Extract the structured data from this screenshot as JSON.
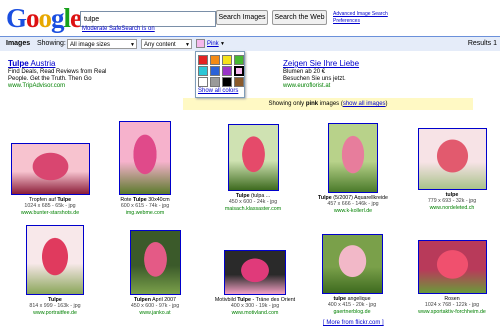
{
  "logo": "Google",
  "search": {
    "value": "tulpe"
  },
  "buttons": {
    "images": "Search Images",
    "web": "Search the Web"
  },
  "links": {
    "advanced": "Advanced Image Search",
    "preferences": "Preferences",
    "safesearch": "Moderate SafeSearch is on"
  },
  "toolbar": {
    "images": "Images",
    "showing": "Showing:",
    "size": "All image sizes",
    "content": "Any content",
    "color": "Pink",
    "results": "Results 1"
  },
  "color_panel": {
    "swatches": [
      "#e32222",
      "#f48a14",
      "#f6e21c",
      "#47b733",
      "#2cc6d6",
      "#2b62d8",
      "#9b35c9",
      "#f5b8ec",
      "#ffffff",
      "#9a9a9a",
      "#000000",
      "#8b5a2b"
    ],
    "all_colors": "Show all colors"
  },
  "ads": {
    "left": {
      "title_pre": "Tulpe",
      "title_post": " Austria",
      "line1": "Find Deals, Read Reviews from Real",
      "line2": "People. Get the Truth. Then Go",
      "url": "www.TripAdvisor.com"
    },
    "right": {
      "title": "Zeigen Sie Ihre Liebe",
      "line1": "Blumen ab 20 €",
      "line2": "Besuchen Sie uns jetzt.",
      "url": "www.euroflorist.at"
    }
  },
  "notice": {
    "pre": "Showing only ",
    "word": "pink",
    "mid": " images (",
    "link": "show all images",
    "post": ")"
  },
  "results": [
    {
      "cap_pre": "Tropfen auf ",
      "cap_bold": "Tulpe",
      "cap_post": "",
      "meta": "1024 x 685 - 65k - jpg",
      "url": "www.bunter-starshots.de",
      "colors": [
        "#f7c3cf",
        "#d94670",
        "#8b1d38"
      ]
    },
    {
      "cap_pre": "Rote ",
      "cap_bold": "Tulpe",
      "cap_post": " 30x40cm",
      "meta": "600 x 615 - 74k - jpg",
      "url": "img.webme.com",
      "colors": [
        "#f6b2cc",
        "#e04a8a",
        "#5b7a2c"
      ]
    },
    {
      "cap_pre": "",
      "cap_bold": "Tulpe",
      "cap_post": " (tulpa ...",
      "meta": "450 x 600 - 24k - jpg",
      "url": "maisach.klassaster.com",
      "colors": [
        "#cfe2b2",
        "#e54a6a",
        "#3e6b1f"
      ]
    },
    {
      "cap_pre": "",
      "cap_bold": "Tulpe",
      "cap_post": " (5/2007) Aquarellkreide",
      "meta": "457 x 666 - 146k - jpg",
      "url": "www.k-kollerl.de",
      "colors": [
        "#b8d28a",
        "#e77d9c",
        "#4a7a2a"
      ]
    },
    {
      "cap_pre": "",
      "cap_bold": "tulpe",
      "cap_post": "",
      "meta": "779 x 693 - 32k - jpg",
      "url": "www.nordeleted.ch",
      "colors": [
        "#f7e3e6",
        "#e25a6e",
        "#a8c28a"
      ]
    },
    {
      "cap_pre": "",
      "cap_bold": "Tulpe",
      "cap_post": "",
      "meta": "814 x 999 - 163k - jpg",
      "url": "www.portraitfee.de",
      "colors": [
        "#f8e8ea",
        "#e03a5e",
        "#8aa65a"
      ]
    },
    {
      "cap_pre": "",
      "cap_bold": "Tulpen",
      "cap_post": " April 2007",
      "meta": "450 x 600 - 97k - jpg",
      "url": "www.janko.at",
      "colors": [
        "#3b5a2a",
        "#e45a86",
        "#7aa04a"
      ]
    },
    {
      "cap_pre": "Motivbild ",
      "cap_bold": "Tulpe",
      "cap_post": " - Träne des Orient",
      "meta": "400 x 300 - 19k - jpg",
      "url": "www.motivland.com",
      "colors": [
        "#2a2a2a",
        "#e03a7a",
        "#f4a0c4"
      ]
    },
    {
      "cap_pre": "",
      "cap_bold": "tulpe",
      "cap_post": " angelique",
      "meta": "400 x 415 - 20k - jpg",
      "url": "gaertnerblog.de",
      "colors": [
        "#7aa04a",
        "#f2b8c8",
        "#3e6b1f"
      ]
    },
    {
      "cap_pre": "Rosen",
      "cap_bold": "",
      "cap_post": "",
      "meta": "1024 x 768 - 122k - jpg",
      "url": "www.sportaktiv-forchheim.de",
      "colors": [
        "#b83a5a",
        "#f0506e",
        "#6a9a3a"
      ]
    }
  ],
  "more_link": "[ More from flickr.com ]"
}
